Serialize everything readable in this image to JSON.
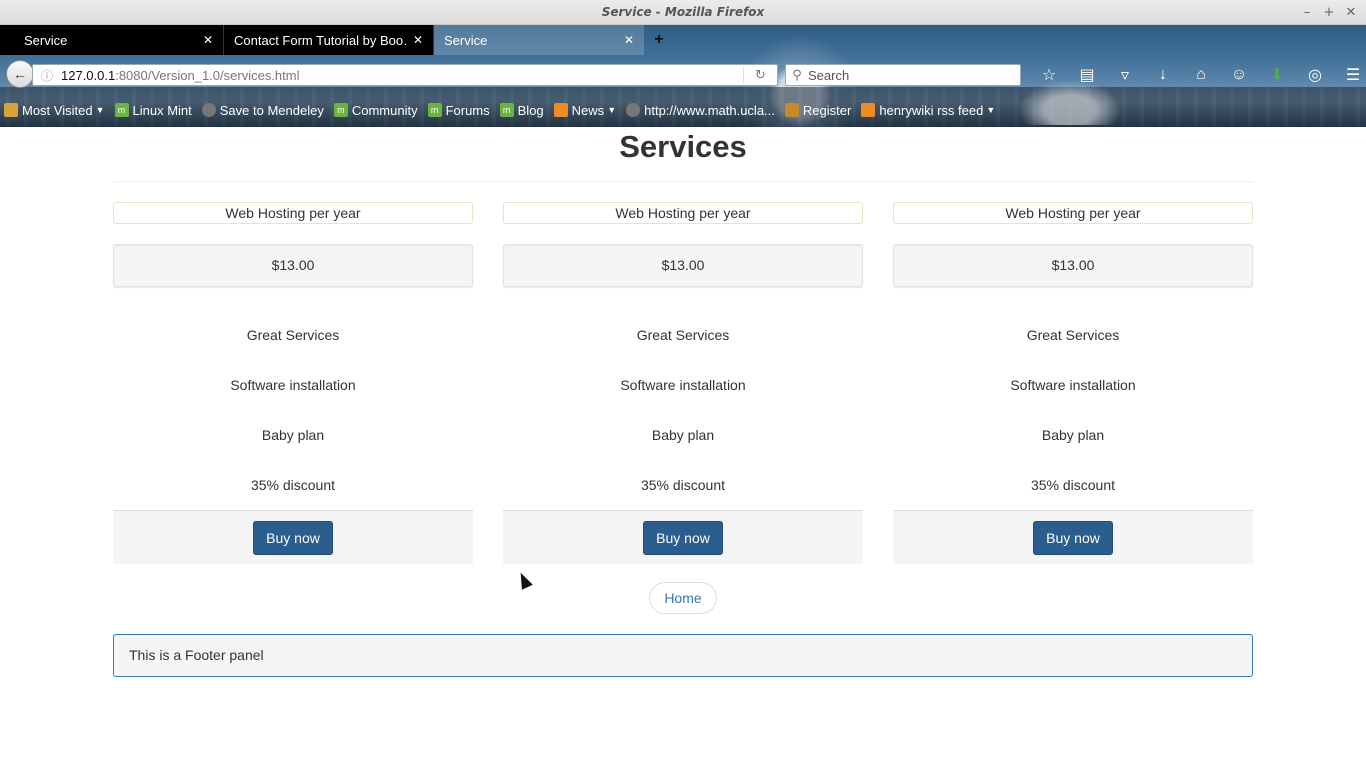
{
  "window": {
    "title": "Service - Mozilla Firefox"
  },
  "tabs": [
    {
      "label": "Service",
      "active": false
    },
    {
      "label": "Contact Form Tutorial by Boo…",
      "active": false
    },
    {
      "label": "Service",
      "active": true
    }
  ],
  "navigation": {
    "url_host": "127.0.0.1",
    "url_rest": ":8080/Version_1.0/services.html",
    "search_placeholder": "Search"
  },
  "bookmarks": [
    {
      "label": "Most Visited",
      "icon": "folder-icon",
      "dropdown": true
    },
    {
      "label": "Linux Mint",
      "icon": "mint-icon"
    },
    {
      "label": "Save to Mendeley",
      "icon": "globe-icon"
    },
    {
      "label": "Community",
      "icon": "mint-icon"
    },
    {
      "label": "Forums",
      "icon": "mint-icon"
    },
    {
      "label": "Blog",
      "icon": "mint-icon"
    },
    {
      "label": "News",
      "icon": "rss-icon",
      "dropdown": true
    },
    {
      "label": "http://www.math.ucla...",
      "icon": "globe-icon"
    },
    {
      "label": "Register",
      "icon": "w3c-icon"
    },
    {
      "label": "henrywiki rss feed",
      "icon": "rss-icon",
      "dropdown": true
    }
  ],
  "page": {
    "title": "Services",
    "cards": [
      {
        "header": "Web Hosting per year",
        "price": "$13.00",
        "features": [
          "Great Services",
          "Software installation",
          "Baby plan",
          "35% discount"
        ],
        "button": "Buy now"
      },
      {
        "header": "Web Hosting per year",
        "price": "$13.00",
        "features": [
          "Great Services",
          "Software installation",
          "Baby plan",
          "35% discount"
        ],
        "button": "Buy now"
      },
      {
        "header": "Web Hosting per year",
        "price": "$13.00",
        "features": [
          "Great Services",
          "Software installation",
          "Baby plan",
          "35% discount"
        ],
        "button": "Buy now"
      }
    ],
    "home_link": "Home",
    "footer": "This is a Footer panel"
  },
  "colors": {
    "accent": "#337ab7",
    "button": "#2b5d8f"
  }
}
